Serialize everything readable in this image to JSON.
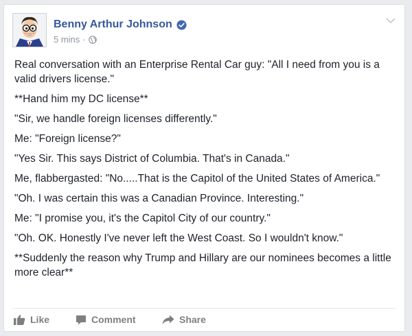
{
  "post": {
    "author": "Benny Arthur Johnson",
    "timestamp": "5 mins",
    "separator": "·",
    "verified_icon": "verified-badge-icon",
    "audience_icon": "globe-icon",
    "menu_icon": "chevron-down-icon",
    "paragraphs": [
      "Real conversation with an Enterprise Rental Car guy: \"All I need from you is a valid drivers license.\"",
      "**Hand him my DC license**",
      "\"Sir, we handle foreign licenses differently.\"",
      "Me: \"Foreign license?\"",
      "\"Yes Sir. This says District of Columbia. That's in Canada.\"",
      "Me, flabbergasted: \"No.....That is the Capitol of the United States of America.\"",
      "\"Oh. I was certain this was a Canadian Province. Interesting.\"",
      "Me: \"I promise you, it's the Capitol City of our country.\"",
      "\"Oh. OK. Honestly I've never left the West Coast. So I wouldn't know.\"",
      "**Suddenly the reason why Trump and Hillary are our nominees becomes a little more clear**"
    ]
  },
  "actions": {
    "like_label": "Like",
    "comment_label": "Comment",
    "share_label": "Share"
  },
  "colors": {
    "author_link": "#365899",
    "verified": "#4267b2",
    "meta_text": "#90949c",
    "action_text": "#7f7f7f"
  }
}
